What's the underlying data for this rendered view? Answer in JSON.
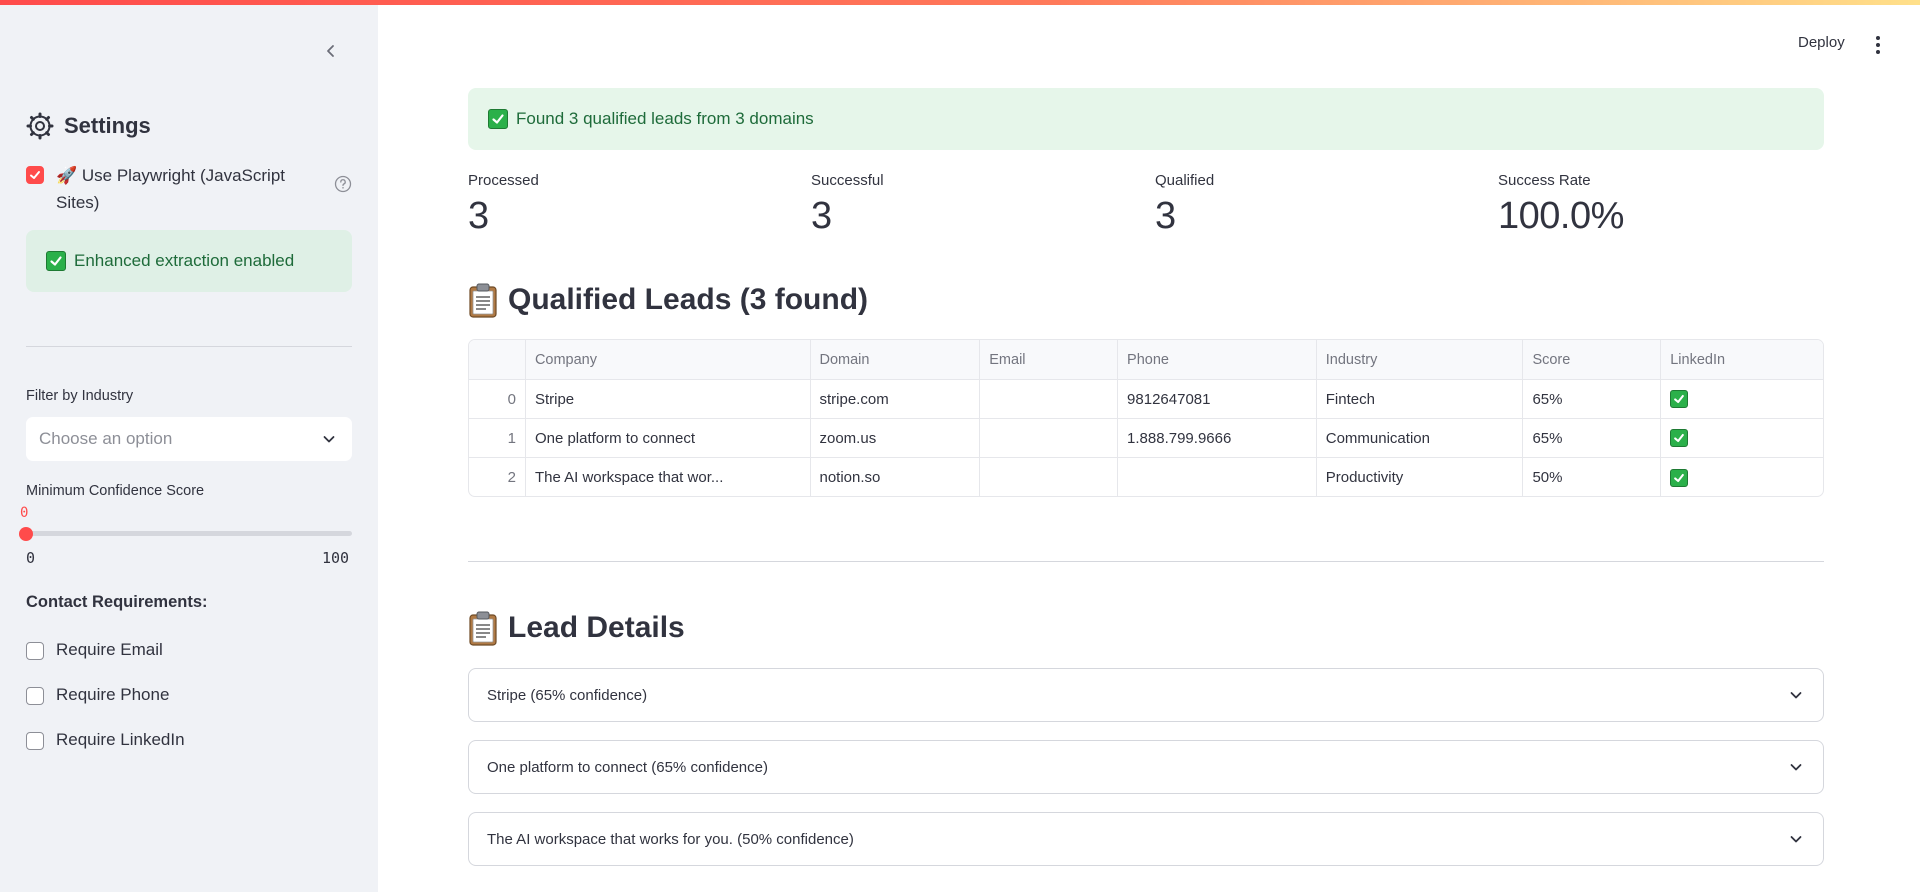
{
  "sidebar": {
    "title": "Settings",
    "playwright_label": "🚀 Use Playwright (JavaScript Sites)",
    "playwright_checked": true,
    "enhanced_alert": "Enhanced extraction enabled",
    "filter_label": "Filter by Industry",
    "filter_placeholder": "Choose an option",
    "confidence_label": "Minimum Confidence Score",
    "confidence_value": "0",
    "confidence_min": "0",
    "confidence_max": "100",
    "contact_heading": "Contact Requirements:",
    "require_email": "Require Email",
    "require_phone": "Require Phone",
    "require_linkedin": "Require LinkedIn"
  },
  "header": {
    "deploy_label": "Deploy"
  },
  "main": {
    "success_alert": "Found 3 qualified leads from 3 domains",
    "metrics": [
      {
        "label": "Processed",
        "value": "3"
      },
      {
        "label": "Successful",
        "value": "3"
      },
      {
        "label": "Qualified",
        "value": "3"
      },
      {
        "label": "Success Rate",
        "value": "100.0%"
      }
    ],
    "leads_heading": "Qualified Leads (3 found)",
    "table": {
      "columns": [
        "",
        "Company",
        "Domain",
        "Email",
        "Phone",
        "Industry",
        "Score",
        "LinkedIn"
      ],
      "rows": [
        {
          "idx": "0",
          "company": "Stripe",
          "domain": "stripe.com",
          "email": "",
          "phone": "9812647081",
          "industry": "Fintech",
          "score": "65%",
          "linkedin": "✅"
        },
        {
          "idx": "1",
          "company": "One platform to connect",
          "domain": "zoom.us",
          "email": "",
          "phone": "1.888.799.9666",
          "industry": "Communication",
          "score": "65%",
          "linkedin": "✅"
        },
        {
          "idx": "2",
          "company": "The AI workspace that wor...",
          "domain": "notion.so",
          "email": "",
          "phone": "",
          "industry": "Productivity",
          "score": "50%",
          "linkedin": "✅"
        }
      ]
    },
    "details_heading": "Lead Details",
    "expanders": [
      "Stripe (65% confidence)",
      "One platform to connect (65% confidence)",
      "The AI workspace that works for you. (50% confidence)"
    ]
  },
  "colors": {
    "accent": "#ff4b4b",
    "success_bg": "#e6f6ea",
    "success_text": "#1e6b3a",
    "sidebar_bg": "#f0f2f6"
  },
  "icons": {
    "collapse": "chevron-left-icon",
    "settings": "gear-icon",
    "help": "help-circle-icon",
    "check": "check-mark-emoji-icon",
    "clipboard": "clipboard-icon",
    "dropdown": "chevron-down-icon",
    "menu": "kebab-menu-icon"
  }
}
